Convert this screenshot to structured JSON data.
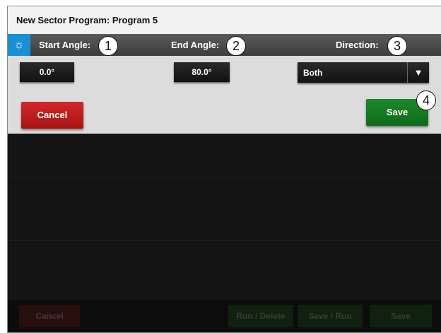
{
  "window": {
    "title": "New Sector Program: Program 5"
  },
  "header": {
    "start_angle_label": "Start Angle:",
    "end_angle_label": "End Angle:",
    "direction_label": "Direction:",
    "gear_icon": "gear-icon"
  },
  "fields": {
    "start_angle": "0.0°",
    "end_angle": "80.0°",
    "direction": "Both"
  },
  "buttons": {
    "cancel": "Cancel",
    "save": "Save"
  },
  "callouts": {
    "c1": "1",
    "c2": "2",
    "c3": "3",
    "c4": "4"
  },
  "footer": {
    "cancel": "Cancel",
    "run_delete": "Run / Delete",
    "save_run": "Save / Run",
    "save": "Save"
  },
  "colors": {
    "accent_blue": "#1a8fd6",
    "cancel_red": "#c21f1f",
    "save_green": "#157a22"
  }
}
